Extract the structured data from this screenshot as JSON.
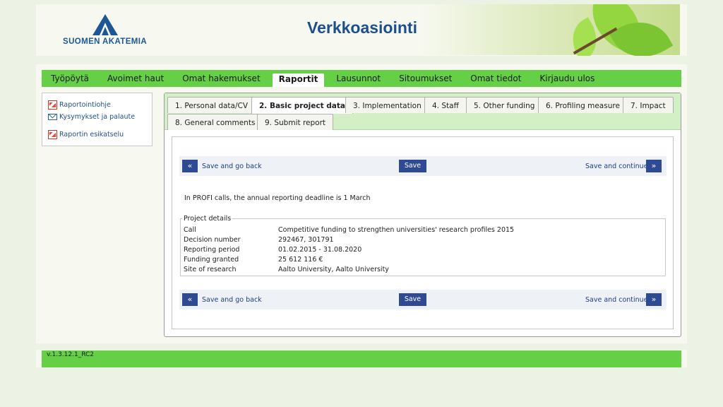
{
  "header": {
    "brand": "SUOMEN AKATEMIA",
    "title": "Verkkoasiointi"
  },
  "topnav": {
    "items": [
      "Työpöytä",
      "Avoimet haut",
      "Omat hakemukset",
      "Raportit",
      "Lausunnot",
      "Sitoumukset",
      "Omat tiedot",
      "Kirjaudu ulos"
    ],
    "active": "Raportit"
  },
  "sidebar": {
    "items": [
      {
        "label": "Raportointiohje",
        "icon": "pdf-icon"
      },
      {
        "label": "Kysymykset ja palaute",
        "icon": "mail-icon"
      },
      {
        "label": "Raportin esikatselu",
        "icon": "pdf-icon"
      }
    ]
  },
  "tabs": {
    "items": [
      "1. Personal data/CV",
      "2. Basic project data",
      "3. Implementation",
      "4. Staff",
      "5. Other funding",
      "6. Profiling measure",
      "7. Impact",
      "8. General comments",
      "9. Submit report"
    ],
    "active": "2. Basic project data"
  },
  "actions": {
    "prev_symbol": "«",
    "back_label": "Save and go back",
    "save_label": "Save",
    "continue_label": "Save and continue",
    "next_symbol": "»"
  },
  "deadline_note": "In PROFI calls, the annual reporting deadline is 1 March",
  "project_details": {
    "legend": "Project details",
    "rows": [
      {
        "key": "Call",
        "value": "Competitive funding to strengthen universities' research profiles 2015"
      },
      {
        "key": "Decision number",
        "value": "292467, 301791"
      },
      {
        "key": "Reporting period",
        "value": "01.02.2015 - 31.08.2020"
      },
      {
        "key": "Funding granted",
        "value": "25 612 116 €"
      },
      {
        "key": "Site of research",
        "value": "Aalto University, Aalto University"
      }
    ]
  },
  "footer": {
    "version": "v.1.3.12.1_RC2"
  },
  "colors": {
    "nav_green": "#65d046",
    "brand_blue": "#1d4f8e",
    "button_blue": "#2d4a92",
    "tab_bar": "#d3efc6"
  }
}
